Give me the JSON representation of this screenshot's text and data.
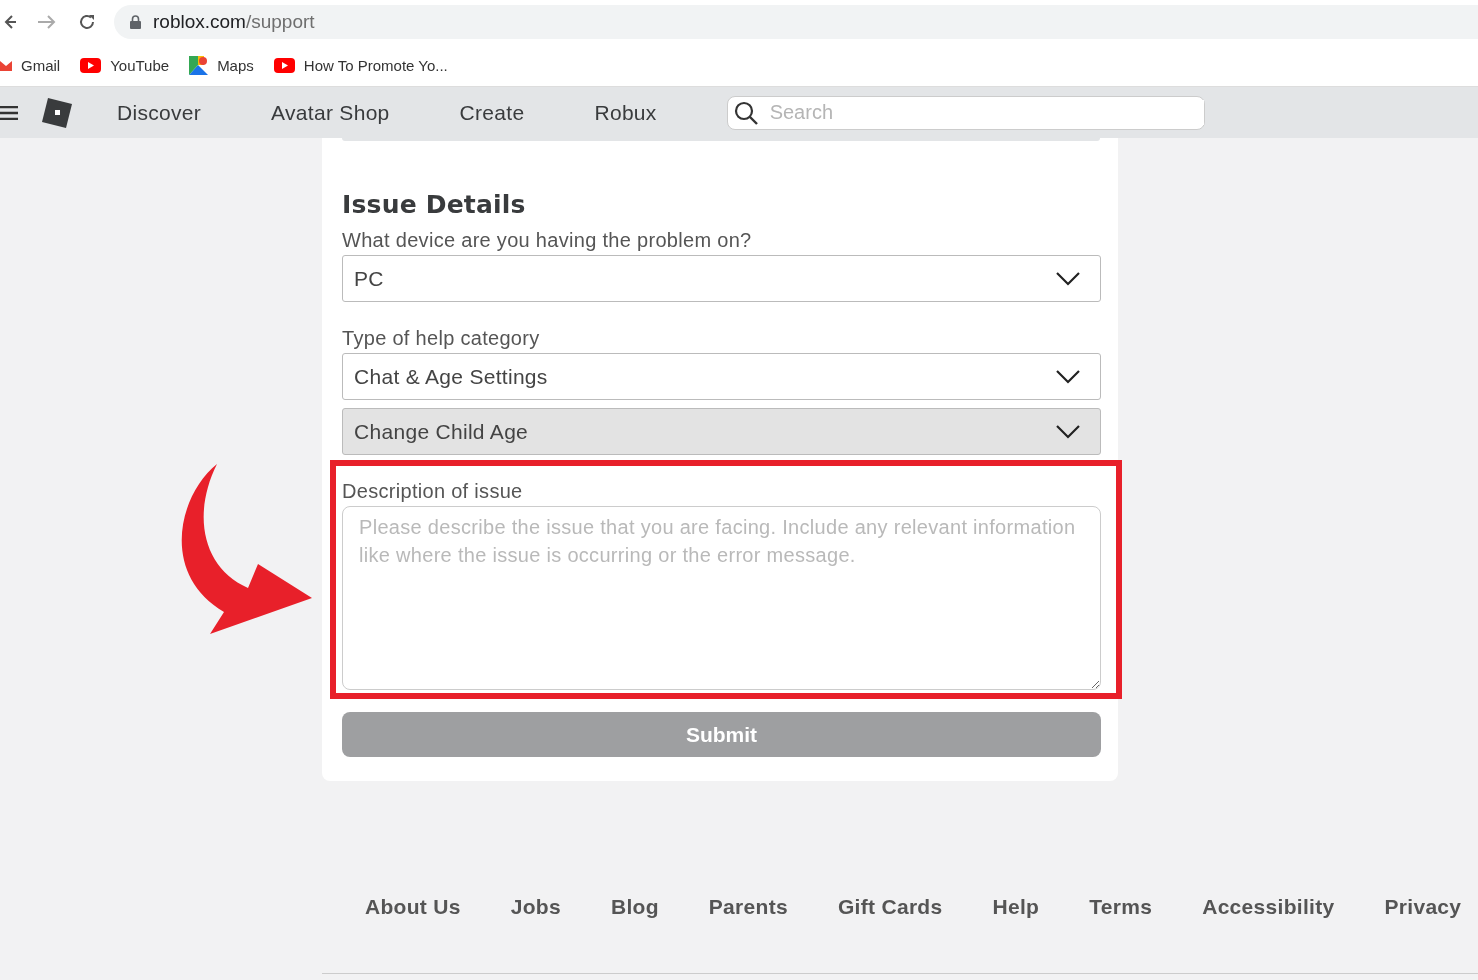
{
  "browser": {
    "url_host": "roblox.com",
    "url_path": "/support",
    "bookmarks": [
      {
        "kind": "gmail",
        "label": "Gmail"
      },
      {
        "kind": "youtube",
        "label": "YouTube"
      },
      {
        "kind": "maps",
        "label": "Maps"
      },
      {
        "kind": "youtube",
        "label": "How To Promote Yo..."
      }
    ]
  },
  "nav": {
    "links": [
      "Discover",
      "Avatar Shop",
      "Create",
      "Robux"
    ],
    "search": {
      "placeholder": "Search"
    }
  },
  "form": {
    "title": "Issue Details",
    "fields": [
      {
        "kind": "select",
        "label": "What device are you having the problem on?",
        "value": "PC",
        "disabled": false
      },
      {
        "kind": "select",
        "label": "Type of help category",
        "value": "Chat & Age Settings",
        "disabled": false
      },
      {
        "kind": "select",
        "value": "Change Child Age",
        "disabled": true
      },
      {
        "kind": "textarea",
        "label": "Description of issue",
        "placeholder": "Please describe the issue that you are facing. Include any relevant information like where the issue is occurring or the error message.",
        "highlighted": true
      }
    ],
    "submit": {
      "label": "Submit",
      "disabled": true
    }
  },
  "footer": {
    "links": [
      "About Us",
      "Jobs",
      "Blog",
      "Parents",
      "Gift Cards",
      "Help",
      "Terms",
      "Accessibility",
      "Privacy"
    ]
  }
}
